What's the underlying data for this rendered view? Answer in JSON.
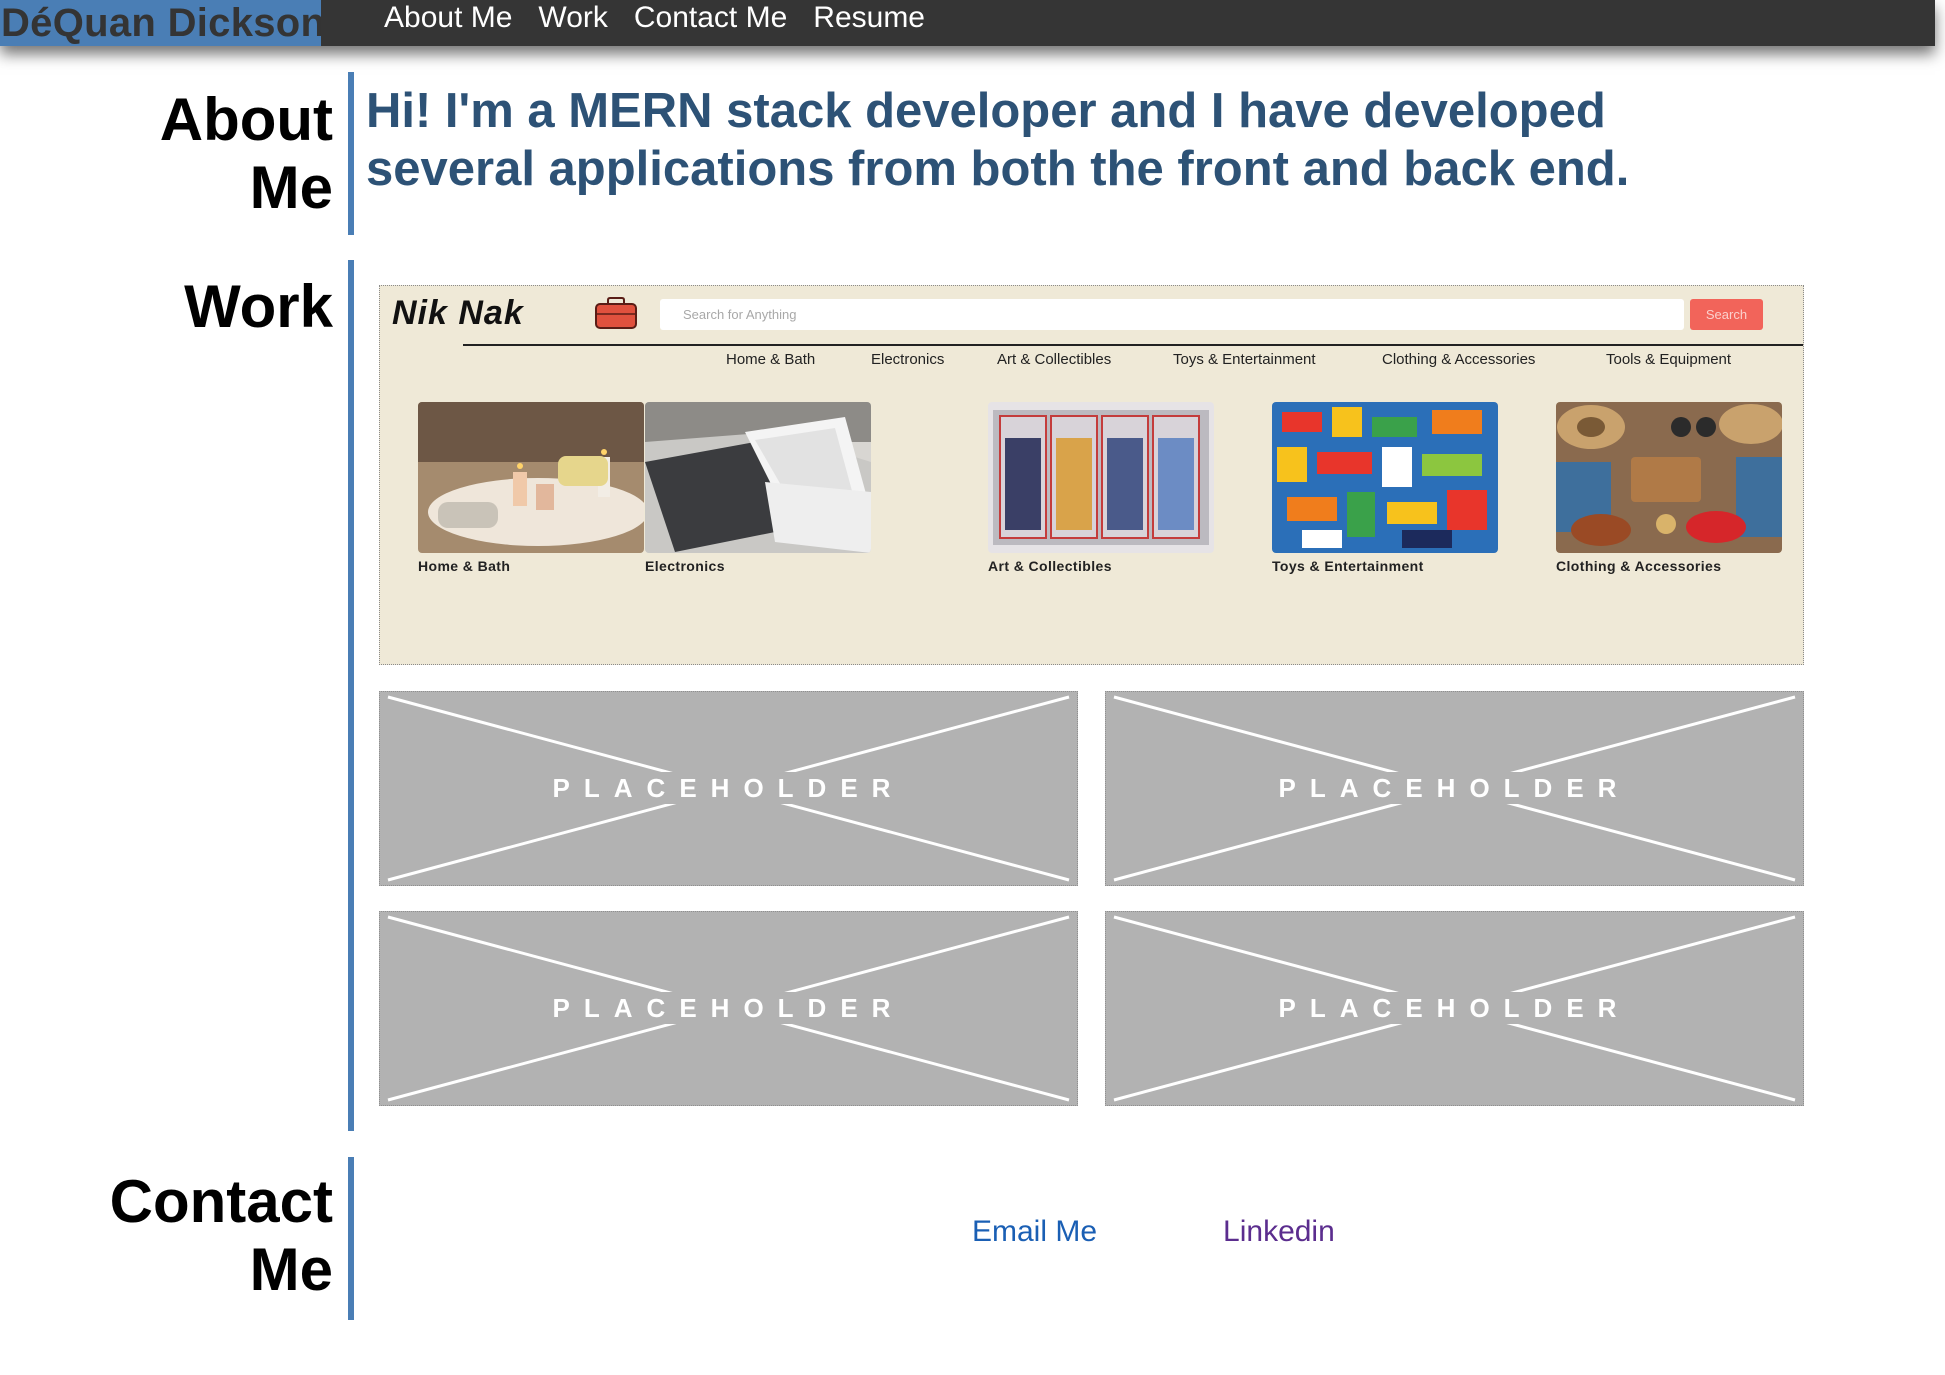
{
  "nav": {
    "brand": "DéQuan Dickson",
    "links": [
      "About Me",
      "Work",
      "Contact Me",
      "Resume"
    ]
  },
  "about": {
    "title_line1": "About",
    "title_line2": "Me",
    "text": "Hi! I'm a MERN stack developer and I have developed several applications from both the front and back end."
  },
  "work": {
    "title": "Work",
    "project": {
      "logo": "Nik Nak",
      "search_placeholder": "Search for Anything",
      "search_button": "Search",
      "categories": [
        "Home & Bath",
        "Electronics",
        "Art & Collectibles",
        "Toys & Entertainment",
        "Clothing & Accessories",
        "Tools & Equipment"
      ],
      "tiles": [
        "Home & Bath",
        "Electronics",
        "Art & Collectibles",
        "Toys & Entertainment",
        "Clothing & Accessories"
      ]
    },
    "placeholders": [
      "PLACEHOLDER",
      "PLACEHOLDER",
      "PLACEHOLDER",
      "PLACEHOLDER"
    ]
  },
  "contact": {
    "title_line1": "Contact",
    "title_line2": "Me",
    "email_label": "Email Me",
    "linkedin_label": "Linkedin"
  },
  "colors": {
    "topbar": "#353535",
    "brand_bg": "#4a7eb5",
    "accent_bar": "#4a7eb5",
    "about_text": "#2d5276",
    "email_link": "#1a5fb4",
    "linkedin_link": "#5b2d8e",
    "project_bg": "#efe9d7",
    "search_button": "#f2645a"
  }
}
